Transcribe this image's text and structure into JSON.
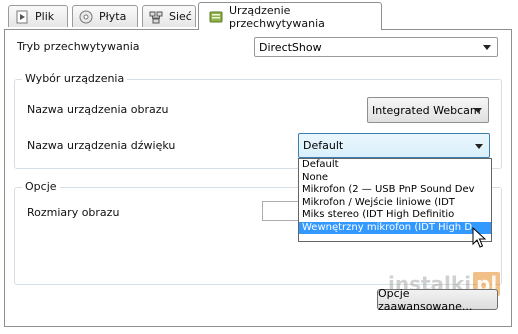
{
  "tabs": [
    {
      "label": "Plik",
      "icon": "file-icon",
      "active": false
    },
    {
      "label": "Płyta",
      "icon": "disc-icon",
      "active": false
    },
    {
      "label": "Sieć",
      "icon": "network-icon",
      "active": false
    },
    {
      "label": "Urządzenie przechwytywania",
      "icon": "capture-device-icon",
      "active": true
    }
  ],
  "capture_mode": {
    "label": "Tryb przechwytywania",
    "value": "DirectShow"
  },
  "device_group": {
    "title": "Wybór urządzenia",
    "video_label": "Nazwa urządzenia obrazu",
    "video_value": "Integrated Webcam",
    "audio_label": "Nazwa urządzenia dźwięku",
    "audio_value": "Default",
    "audio_options": [
      "Default",
      "None",
      "Mikrofon (2 — USB PnP Sound Dev",
      "Mikrofon / Wejście liniowe (IDT",
      "Miks stereo (IDT High Definitio",
      "Wewnętrzny mikrofon (IDT High D"
    ],
    "audio_highlighted_index": 5
  },
  "options_group": {
    "title": "Opcje",
    "size_label": "Rozmiary obrazu",
    "size_value": ""
  },
  "advanced_button": "Opcje zaawansowane...",
  "watermark": {
    "text": "instalki",
    "badge": "pl"
  },
  "colors": {
    "selection": "#3399ff",
    "focus_border": "#3c7fb1"
  }
}
